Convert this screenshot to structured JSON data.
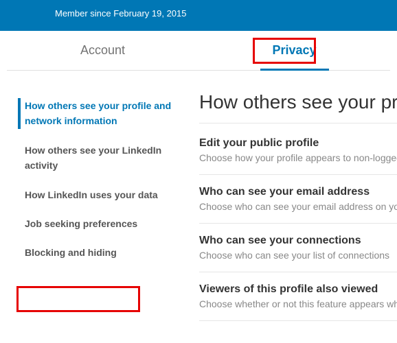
{
  "header": {
    "member_since": "Member since February 19, 2015"
  },
  "tabs": {
    "account": "Account",
    "privacy": "Privacy"
  },
  "sidebar": {
    "items": [
      "How others see your profile and network information",
      "How others see your LinkedIn activity",
      "How LinkedIn uses your data",
      "Job seeking preferences",
      "Blocking and hiding"
    ]
  },
  "main": {
    "heading": "How others see your profile and network information",
    "settings": [
      {
        "title": "Edit your public profile",
        "desc": "Choose how your profile appears to non-logged in members via search engines or permitted services"
      },
      {
        "title": "Who can see your email address",
        "desc": "Choose who can see your email address on your profile"
      },
      {
        "title": "Who can see your connections",
        "desc": "Choose who can see your list of connections"
      },
      {
        "title": "Viewers of this profile also viewed",
        "desc": "Choose whether or not this feature appears when people view your profile"
      }
    ]
  }
}
